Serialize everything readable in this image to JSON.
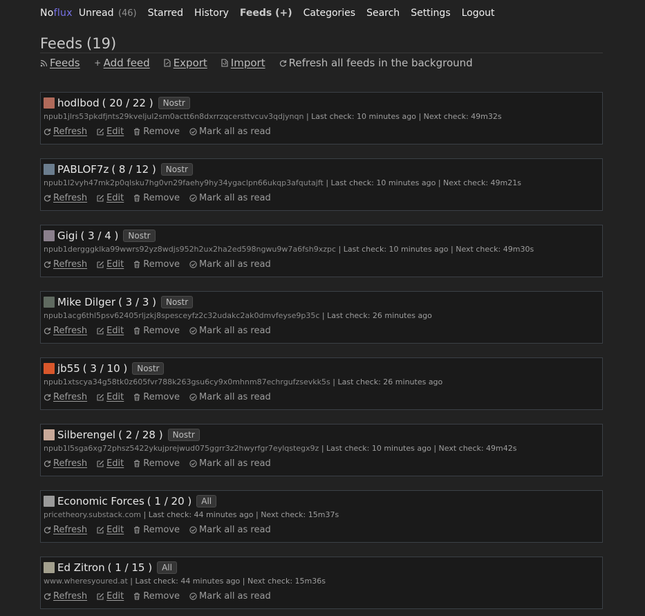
{
  "app": {
    "logo_no": "No",
    "logo_flux": "flux"
  },
  "nav": {
    "unread_label": "Unread",
    "unread_count": "(46)",
    "starred": "Starred",
    "history": "History",
    "feeds": "Feeds (+)",
    "categories": "Categories",
    "search": "Search",
    "settings": "Settings",
    "logout": "Logout"
  },
  "page": {
    "title": "Feeds",
    "count": "(19)",
    "subnav": {
      "feeds": "Feeds",
      "add_feed": "Add feed",
      "export": "Export",
      "import": "Import",
      "refresh_all": "Refresh all feeds in the background"
    }
  },
  "feed_actions": {
    "refresh": "Refresh",
    "edit": "Edit",
    "remove": "Remove",
    "mark_all": "Mark all as read"
  },
  "feeds": [
    {
      "title": "hodlbod",
      "counts": "( 20 / 22 )",
      "category": "Nostr",
      "url": "npub1jlrs53pkdfjnts29kveljul2sm0actt6n8dxrrzqcersttvcuv3qdjynqn",
      "last_check": "| Last check: 10 minutes ago",
      "next_check": "| Next check: 49m32s",
      "avatar_color": "#b06a5a"
    },
    {
      "title": "PABLOF7z",
      "counts": "( 8 / 12 )",
      "category": "Nostr",
      "url": "npub1l2vyh47mk2p0qlsku7hg0vn29faehy9hy34ygaclpn66ukqp3afqutajft",
      "last_check": "| Last check: 10 minutes ago",
      "next_check": "| Next check: 49m21s",
      "avatar_color": "#6b7d8e"
    },
    {
      "title": "Gigi",
      "counts": "( 3 / 4 )",
      "category": "Nostr",
      "url": "npub1dergggklka99wwrs92yz8wdjs952h2ux2ha2ed598ngwu9w7a6fsh9xzpc",
      "last_check": "| Last check: 10 minutes ago",
      "next_check": "| Next check: 49m30s",
      "avatar_color": "#8a7f8c"
    },
    {
      "title": "Mike Dilger",
      "counts": "( 3 / 3 )",
      "category": "Nostr",
      "url": "npub1acg6thl5psv62405rljzkj8spesceyfz2c32udakc2ak0dmvfeyse9p35c",
      "last_check": "| Last check: 26 minutes ago",
      "next_check": "",
      "avatar_color": "#5f6a60"
    },
    {
      "title": "jb55",
      "counts": "( 3 / 10 )",
      "category": "Nostr",
      "url": "npub1xtscya34g58tk0z605fvr788k263gsu6cy9x0mhnm87echrgufzsevkk5s",
      "last_check": "| Last check: 26 minutes ago",
      "next_check": "",
      "avatar_color": "#d9572b"
    },
    {
      "title": "Silberengel",
      "counts": "( 2 / 28 )",
      "category": "Nostr",
      "url": "npub1l5sga6xg72phsz5422ykujprejwud075ggrr3z2hwyrfgr7eylqstegx9z",
      "last_check": "| Last check: 10 minutes ago",
      "next_check": "| Next check: 49m42s",
      "avatar_color": "#c8a898"
    },
    {
      "title": "Economic Forces",
      "counts": "( 1 / 20 )",
      "category": "All",
      "url": "pricetheory.substack.com",
      "last_check": "| Last check: 44 minutes ago",
      "next_check": "| Next check: 15m37s",
      "avatar_color": "#9a9a9a"
    },
    {
      "title": "Ed Zitron",
      "counts": "( 1 / 15 )",
      "category": "All",
      "url": "www.wheresyoured.at",
      "last_check": "| Last check: 44 minutes ago",
      "next_check": "| Next check: 15m36s",
      "avatar_color": "#a3a08e"
    }
  ]
}
